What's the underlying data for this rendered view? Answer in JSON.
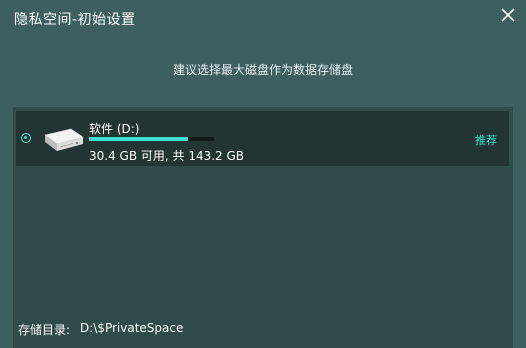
{
  "window": {
    "title": "隐私空间-初始设置"
  },
  "main": {
    "instruction": "建议选择最大磁盘作为数据存储盘"
  },
  "drives": [
    {
      "name": "软件 (D:)",
      "space_text": "30.4 GB 可用, 共 143.2 GB",
      "used_fraction": 0.79,
      "tag": "推荐",
      "selected": true
    }
  ],
  "footer": {
    "storage_label": "存储目录:",
    "storage_path": "D:\\$PrivateSpace"
  },
  "colors": {
    "accent": "#3ee0d0",
    "window_bg": "#3e5f5f",
    "panel_bg": "#314a4a",
    "row_bg": "#233434"
  },
  "icons": {
    "close": "close-icon",
    "drive": "hard-drive-icon",
    "radio": "radio-selected-icon"
  }
}
